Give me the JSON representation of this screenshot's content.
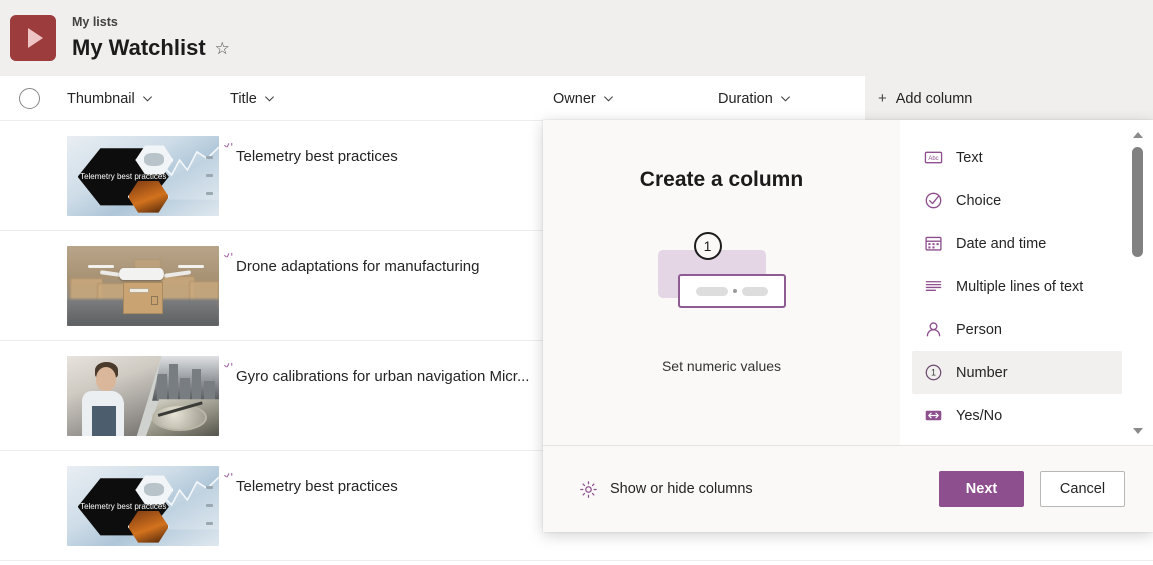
{
  "app": {
    "breadcrumb": "My lists",
    "page_title": "My Watchlist",
    "favorite_icon": "star-outline-icon",
    "logo_icon": "play-triangle-icon",
    "brand_color": "#9c3c3c",
    "accent_color": "#8e4f8e"
  },
  "list": {
    "select_all_icon": "circle-checkbox-icon",
    "columns": [
      {
        "label": "Thumbnail",
        "sort_icon": "chevron-down-icon"
      },
      {
        "label": "Title",
        "sort_icon": "chevron-down-icon"
      },
      {
        "label": "Owner",
        "sort_icon": "chevron-down-icon"
      },
      {
        "label": "Duration",
        "sort_icon": "chevron-down-icon"
      }
    ],
    "add_column": {
      "plus": "+",
      "label": "Add column"
    },
    "rows": [
      {
        "title": "Telemetry best practices",
        "thumbnail": "telemetry-best-practices-thumbnail",
        "thumb_text": "Telemetry best practices",
        "new_icon": "new-sparkle-icon"
      },
      {
        "title": "Drone adaptations for manufacturing",
        "thumbnail": "drone-warehouse-thumbnail",
        "new_icon": "new-sparkle-icon"
      },
      {
        "title": "Gyro calibrations for urban navigation Micr...",
        "thumbnail": "gyro-calibration-collage-thumbnail",
        "new_icon": "new-sparkle-icon"
      },
      {
        "title": "Telemetry best practices",
        "thumbnail": "telemetry-best-practices-thumbnail",
        "thumb_text": "Telemetry best practices",
        "new_icon": "new-sparkle-icon"
      }
    ]
  },
  "dialog": {
    "title": "Create a column",
    "illustration": {
      "badge_label": "1",
      "caption": "Set numeric values"
    },
    "types": [
      {
        "label": "Text",
        "icon": "abc-text-icon",
        "selected": false
      },
      {
        "label": "Choice",
        "icon": "check-circle-icon",
        "selected": false
      },
      {
        "label": "Date and time",
        "icon": "calendar-icon",
        "selected": false
      },
      {
        "label": "Multiple lines of text",
        "icon": "lines-of-text-icon",
        "selected": false
      },
      {
        "label": "Person",
        "icon": "person-icon",
        "selected": false
      },
      {
        "label": "Number",
        "icon": "circled-one-icon",
        "selected": true
      },
      {
        "label": "Yes/No",
        "icon": "toggle-yes-no-icon",
        "selected": false
      }
    ],
    "scrollbar": {
      "up_icon": "scroll-up-arrow-icon",
      "down_icon": "scroll-down-arrow-icon"
    },
    "footer": {
      "show_hide_label": "Show or hide columns",
      "show_hide_icon": "gear-icon",
      "next_label": "Next",
      "cancel_label": "Cancel"
    }
  }
}
